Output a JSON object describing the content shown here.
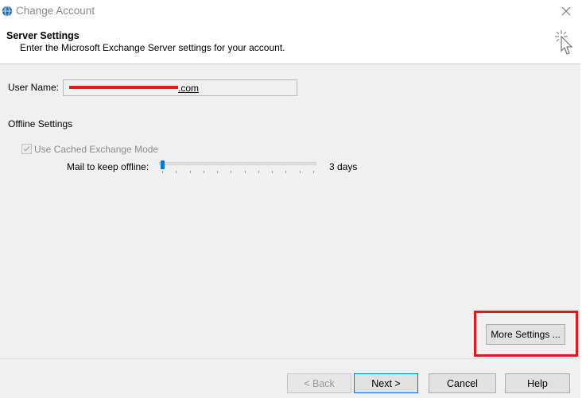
{
  "window": {
    "title": "Change Account"
  },
  "header": {
    "title": "Server Settings",
    "subtitle": "Enter the Microsoft Exchange Server settings for your account."
  },
  "form": {
    "user_name_label": "User Name:",
    "user_name_value": ".com",
    "offline_section_title": "Offline Settings",
    "cached_mode_label": "Use Cached Exchange Mode",
    "cached_mode_checked": true,
    "mail_offline_label": "Mail to keep offline:",
    "mail_offline_value": "3 days",
    "slider_fraction": 0.0
  },
  "buttons": {
    "more_settings": "More Settings ...",
    "back": "< Back",
    "next": "Next >",
    "cancel": "Cancel",
    "help": "Help"
  },
  "colors": {
    "accent": "#0078d7",
    "highlight": "#e8141c"
  },
  "icons": {
    "app": "outlook-globe-icon",
    "wizard": "magic-wand-icon",
    "close": "close-icon"
  }
}
